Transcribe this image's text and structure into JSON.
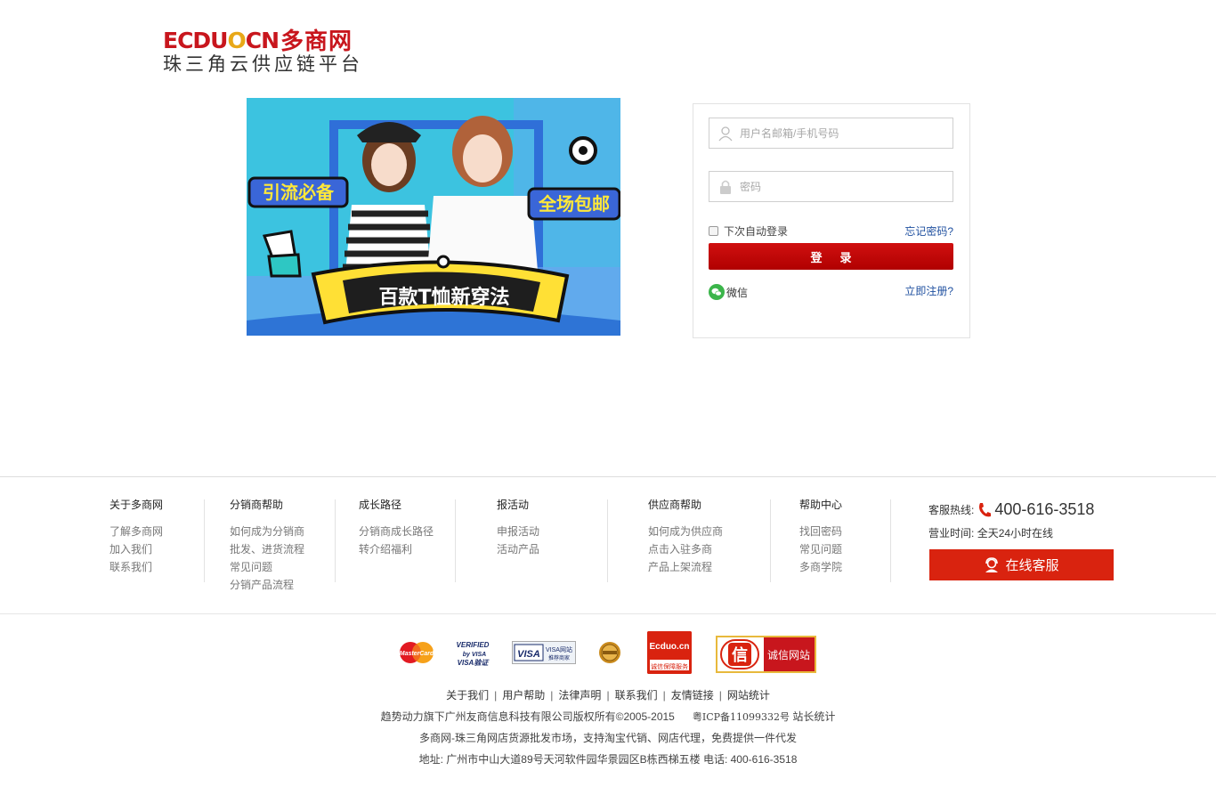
{
  "logo": {
    "brand_en_1": "ECDU",
    "brand_en_o": "O",
    "brand_en_2": "CN",
    "brand_cn": "多商网",
    "tagline": "珠三角云供应链平台"
  },
  "banner": {
    "tag_left": "引流必备",
    "tag_right": "全场包邮",
    "ribbon": "百款T恤新穿法"
  },
  "login": {
    "username_placeholder": "用户名邮箱/手机号码",
    "password_placeholder": "密码",
    "remember_label": "下次自动登录",
    "forgot_link": "忘记密码?",
    "submit_label": "登录",
    "wechat_label": "微信",
    "register_link": "立即注册?"
  },
  "footer": {
    "columns": [
      {
        "title": "关于多商网",
        "links": [
          "了解多商网",
          "加入我们",
          "联系我们"
        ]
      },
      {
        "title": "分销商帮助",
        "links": [
          "如何成为分销商",
          "批发、进货流程",
          "常见问题",
          "分销产品流程"
        ]
      },
      {
        "title": "成长路径",
        "links": [
          "分销商成长路径",
          "转介绍福利"
        ]
      },
      {
        "title": "报活动",
        "links": [
          "申报活动",
          "活动产品"
        ]
      },
      {
        "title": "供应商帮助",
        "links": [
          "如何成为供应商",
          "点击入驻多商",
          "产品上架流程"
        ]
      },
      {
        "title": "帮助中心",
        "links": [
          "找回密码",
          "常见问题",
          "多商学院"
        ]
      }
    ],
    "hotline_label": "客服热线:",
    "hotline_number": "400-616-3518",
    "hours_label": "营业时间:",
    "hours_value": "全天24小时在线",
    "service_button": "在线客服"
  },
  "badges": {
    "mastercard": "MasterCard",
    "vbv_1": "VERIFIED",
    "vbv_2": "by VISA",
    "vbv_3": "VISA验证",
    "visa_main": "VISA",
    "visa_sub1": "VISA网站",
    "visa_sub2": "推荐商家",
    "ecduo_top": "Ecduo.cn",
    "ecduo_bottom": "诚信保障服务",
    "cx_icon": "信",
    "cx_label": "诚信网站"
  },
  "bottom": {
    "links": [
      "关于我们",
      "用户帮助",
      "法律声明",
      "联系我们",
      "友情链接",
      "网站统计"
    ],
    "copyright": "趋势动力旗下广州友商信息科技有限公司版权所有©2005-2015",
    "icp": "粤ICP备11099332号",
    "stats": "站长统计",
    "slogan": "多商网-珠三角网店货源批发市场，支持淘宝代销、网店代理，免费提供一件代发",
    "address": "地址: 广州市中山大道89号天河软件园华景园区B栋西梯五楼 电话: 400-616-3518"
  },
  "colors": {
    "brand_red": "#c8161d",
    "button_red": "#c00000",
    "link_blue": "#1e4f9f",
    "banner_blue": "#3cc3e0",
    "service_red": "#d9230f"
  }
}
